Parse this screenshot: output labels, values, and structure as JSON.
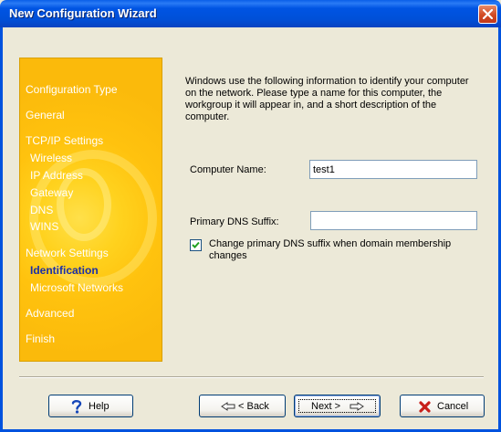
{
  "window": {
    "title": "New Configuration Wizard"
  },
  "sidebar": {
    "items": [
      {
        "label": "Configuration Type"
      },
      {
        "label": "General"
      },
      {
        "label": "TCP/IP Settings"
      },
      {
        "label": "Wireless"
      },
      {
        "label": "IP Address"
      },
      {
        "label": "Gateway"
      },
      {
        "label": "DNS"
      },
      {
        "label": "WINS"
      },
      {
        "label": "Network Settings"
      },
      {
        "label": "Identification"
      },
      {
        "label": "Microsoft Networks"
      },
      {
        "label": "Advanced"
      },
      {
        "label": "Finish"
      }
    ],
    "active": "Identification"
  },
  "content": {
    "description": "Windows use the following information to identify your computer on the network. Please type a name for this computer, the workgroup it will appear in, and a short description of the computer.",
    "computer_name_label": "Computer Name:",
    "computer_name_value": "test1",
    "dns_suffix_label": "Primary DNS Suffix:",
    "dns_suffix_value": "",
    "change_dns_label": "Change primary DNS suffix when domain membership changes",
    "change_dns_checked": true
  },
  "buttons": {
    "help": "Help",
    "back": "< Back",
    "next": "Next >",
    "cancel": "Cancel"
  },
  "colors": {
    "titlebar": "#0054E3",
    "sidebar": "#FFC20E",
    "active_nav": "#1A2FA8"
  }
}
